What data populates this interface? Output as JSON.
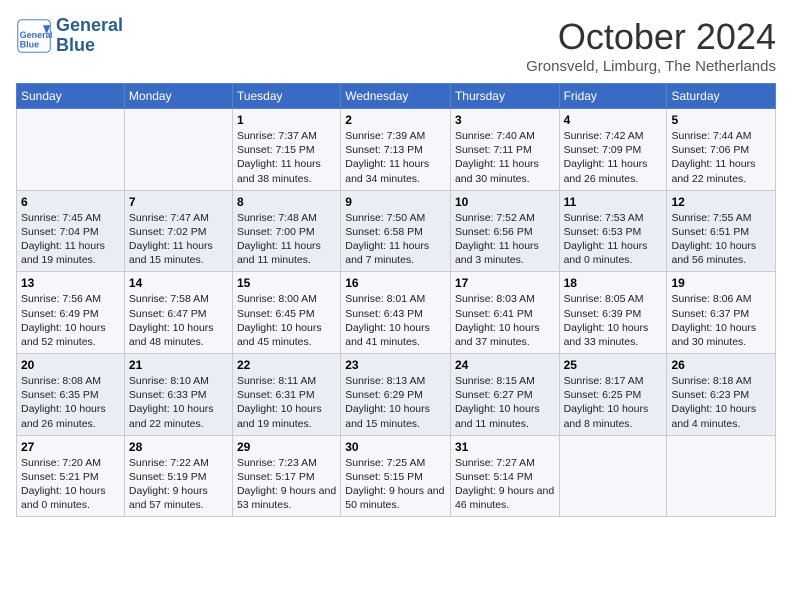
{
  "header": {
    "logo_line1": "General",
    "logo_line2": "Blue",
    "month": "October 2024",
    "location": "Gronsveld, Limburg, The Netherlands"
  },
  "weekdays": [
    "Sunday",
    "Monday",
    "Tuesday",
    "Wednesday",
    "Thursday",
    "Friday",
    "Saturday"
  ],
  "weeks": [
    [
      {
        "day": "",
        "sunrise": "",
        "sunset": "",
        "daylight": ""
      },
      {
        "day": "",
        "sunrise": "",
        "sunset": "",
        "daylight": ""
      },
      {
        "day": "1",
        "sunrise": "Sunrise: 7:37 AM",
        "sunset": "Sunset: 7:15 PM",
        "daylight": "Daylight: 11 hours and 38 minutes."
      },
      {
        "day": "2",
        "sunrise": "Sunrise: 7:39 AM",
        "sunset": "Sunset: 7:13 PM",
        "daylight": "Daylight: 11 hours and 34 minutes."
      },
      {
        "day": "3",
        "sunrise": "Sunrise: 7:40 AM",
        "sunset": "Sunset: 7:11 PM",
        "daylight": "Daylight: 11 hours and 30 minutes."
      },
      {
        "day": "4",
        "sunrise": "Sunrise: 7:42 AM",
        "sunset": "Sunset: 7:09 PM",
        "daylight": "Daylight: 11 hours and 26 minutes."
      },
      {
        "day": "5",
        "sunrise": "Sunrise: 7:44 AM",
        "sunset": "Sunset: 7:06 PM",
        "daylight": "Daylight: 11 hours and 22 minutes."
      }
    ],
    [
      {
        "day": "6",
        "sunrise": "Sunrise: 7:45 AM",
        "sunset": "Sunset: 7:04 PM",
        "daylight": "Daylight: 11 hours and 19 minutes."
      },
      {
        "day": "7",
        "sunrise": "Sunrise: 7:47 AM",
        "sunset": "Sunset: 7:02 PM",
        "daylight": "Daylight: 11 hours and 15 minutes."
      },
      {
        "day": "8",
        "sunrise": "Sunrise: 7:48 AM",
        "sunset": "Sunset: 7:00 PM",
        "daylight": "Daylight: 11 hours and 11 minutes."
      },
      {
        "day": "9",
        "sunrise": "Sunrise: 7:50 AM",
        "sunset": "Sunset: 6:58 PM",
        "daylight": "Daylight: 11 hours and 7 minutes."
      },
      {
        "day": "10",
        "sunrise": "Sunrise: 7:52 AM",
        "sunset": "Sunset: 6:56 PM",
        "daylight": "Daylight: 11 hours and 3 minutes."
      },
      {
        "day": "11",
        "sunrise": "Sunrise: 7:53 AM",
        "sunset": "Sunset: 6:53 PM",
        "daylight": "Daylight: 11 hours and 0 minutes."
      },
      {
        "day": "12",
        "sunrise": "Sunrise: 7:55 AM",
        "sunset": "Sunset: 6:51 PM",
        "daylight": "Daylight: 10 hours and 56 minutes."
      }
    ],
    [
      {
        "day": "13",
        "sunrise": "Sunrise: 7:56 AM",
        "sunset": "Sunset: 6:49 PM",
        "daylight": "Daylight: 10 hours and 52 minutes."
      },
      {
        "day": "14",
        "sunrise": "Sunrise: 7:58 AM",
        "sunset": "Sunset: 6:47 PM",
        "daylight": "Daylight: 10 hours and 48 minutes."
      },
      {
        "day": "15",
        "sunrise": "Sunrise: 8:00 AM",
        "sunset": "Sunset: 6:45 PM",
        "daylight": "Daylight: 10 hours and 45 minutes."
      },
      {
        "day": "16",
        "sunrise": "Sunrise: 8:01 AM",
        "sunset": "Sunset: 6:43 PM",
        "daylight": "Daylight: 10 hours and 41 minutes."
      },
      {
        "day": "17",
        "sunrise": "Sunrise: 8:03 AM",
        "sunset": "Sunset: 6:41 PM",
        "daylight": "Daylight: 10 hours and 37 minutes."
      },
      {
        "day": "18",
        "sunrise": "Sunrise: 8:05 AM",
        "sunset": "Sunset: 6:39 PM",
        "daylight": "Daylight: 10 hours and 33 minutes."
      },
      {
        "day": "19",
        "sunrise": "Sunrise: 8:06 AM",
        "sunset": "Sunset: 6:37 PM",
        "daylight": "Daylight: 10 hours and 30 minutes."
      }
    ],
    [
      {
        "day": "20",
        "sunrise": "Sunrise: 8:08 AM",
        "sunset": "Sunset: 6:35 PM",
        "daylight": "Daylight: 10 hours and 26 minutes."
      },
      {
        "day": "21",
        "sunrise": "Sunrise: 8:10 AM",
        "sunset": "Sunset: 6:33 PM",
        "daylight": "Daylight: 10 hours and 22 minutes."
      },
      {
        "day": "22",
        "sunrise": "Sunrise: 8:11 AM",
        "sunset": "Sunset: 6:31 PM",
        "daylight": "Daylight: 10 hours and 19 minutes."
      },
      {
        "day": "23",
        "sunrise": "Sunrise: 8:13 AM",
        "sunset": "Sunset: 6:29 PM",
        "daylight": "Daylight: 10 hours and 15 minutes."
      },
      {
        "day": "24",
        "sunrise": "Sunrise: 8:15 AM",
        "sunset": "Sunset: 6:27 PM",
        "daylight": "Daylight: 10 hours and 11 minutes."
      },
      {
        "day": "25",
        "sunrise": "Sunrise: 8:17 AM",
        "sunset": "Sunset: 6:25 PM",
        "daylight": "Daylight: 10 hours and 8 minutes."
      },
      {
        "day": "26",
        "sunrise": "Sunrise: 8:18 AM",
        "sunset": "Sunset: 6:23 PM",
        "daylight": "Daylight: 10 hours and 4 minutes."
      }
    ],
    [
      {
        "day": "27",
        "sunrise": "Sunrise: 7:20 AM",
        "sunset": "Sunset: 5:21 PM",
        "daylight": "Daylight: 10 hours and 0 minutes."
      },
      {
        "day": "28",
        "sunrise": "Sunrise: 7:22 AM",
        "sunset": "Sunset: 5:19 PM",
        "daylight": "Daylight: 9 hours and 57 minutes."
      },
      {
        "day": "29",
        "sunrise": "Sunrise: 7:23 AM",
        "sunset": "Sunset: 5:17 PM",
        "daylight": "Daylight: 9 hours and 53 minutes."
      },
      {
        "day": "30",
        "sunrise": "Sunrise: 7:25 AM",
        "sunset": "Sunset: 5:15 PM",
        "daylight": "Daylight: 9 hours and 50 minutes."
      },
      {
        "day": "31",
        "sunrise": "Sunrise: 7:27 AM",
        "sunset": "Sunset: 5:14 PM",
        "daylight": "Daylight: 9 hours and 46 minutes."
      },
      {
        "day": "",
        "sunrise": "",
        "sunset": "",
        "daylight": ""
      },
      {
        "day": "",
        "sunrise": "",
        "sunset": "",
        "daylight": ""
      }
    ]
  ]
}
